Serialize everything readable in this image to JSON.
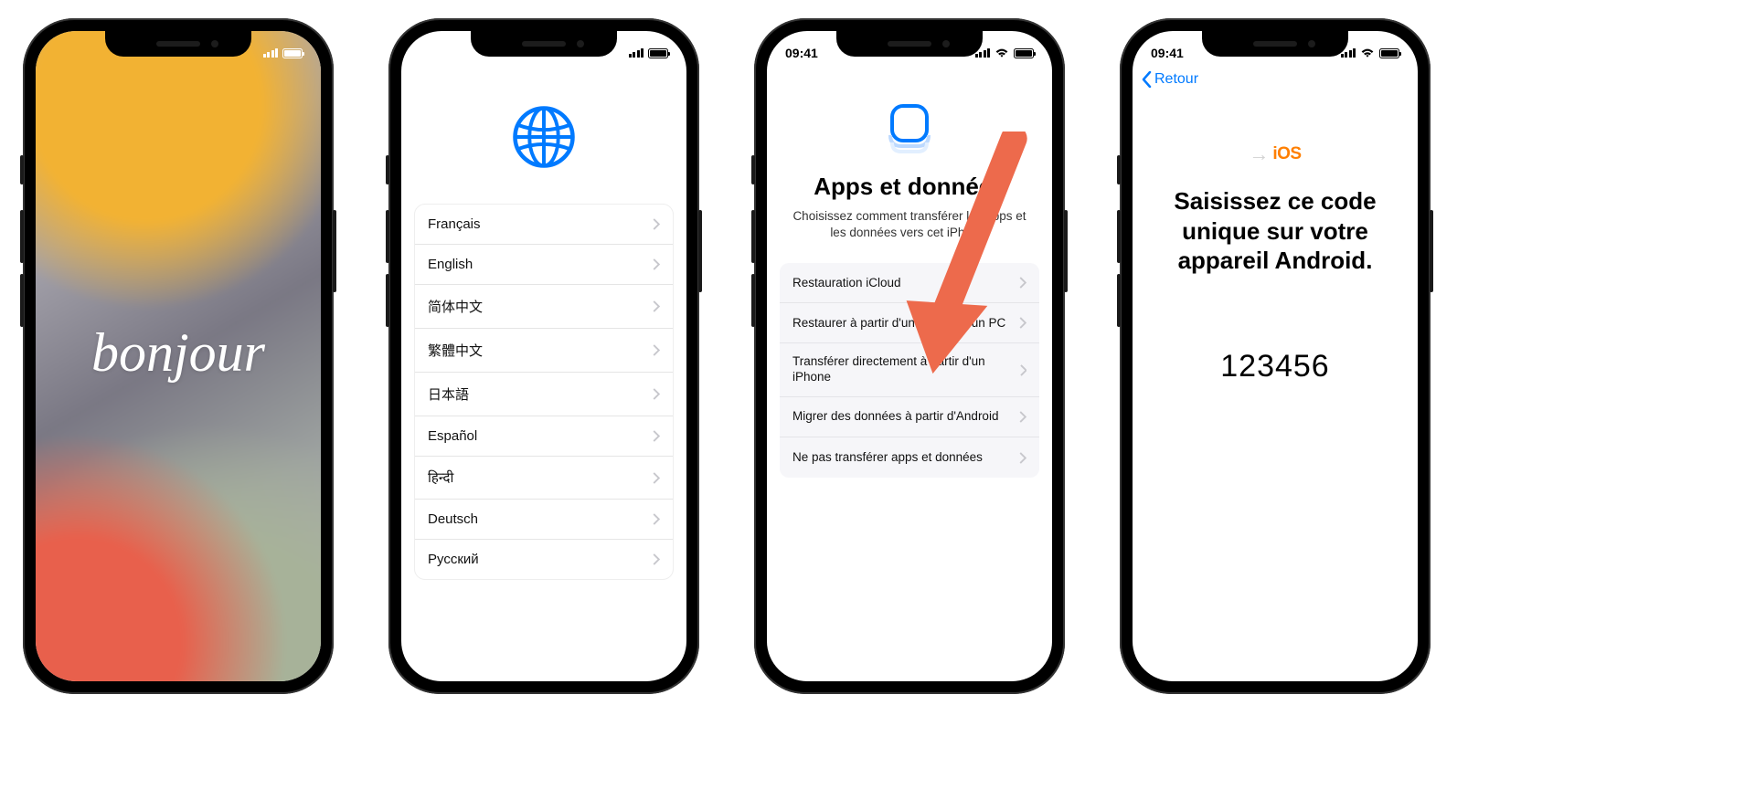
{
  "screen1": {
    "greeting": "bonjour"
  },
  "screen2": {
    "languages": [
      "Français",
      "English",
      "简体中文",
      "繁體中文",
      "日本語",
      "Español",
      "हिन्दी",
      "Deutsch",
      "Русский"
    ]
  },
  "screen3": {
    "time": "09:41",
    "title": "Apps et données",
    "subtitle": "Choisissez comment transférer les apps et les données vers cet iPhone.",
    "options": [
      "Restauration iCloud",
      "Restaurer à partir d'un Mac ou d'un PC",
      "Transférer directement à partir d'un iPhone",
      "Migrer des données à partir d'Android",
      "Ne pas transférer apps et données"
    ]
  },
  "screen4": {
    "time": "09:41",
    "back": "Retour",
    "logo_text": "iOS",
    "title": "Saisissez ce code unique sur votre appareil Android.",
    "code": "123456"
  }
}
